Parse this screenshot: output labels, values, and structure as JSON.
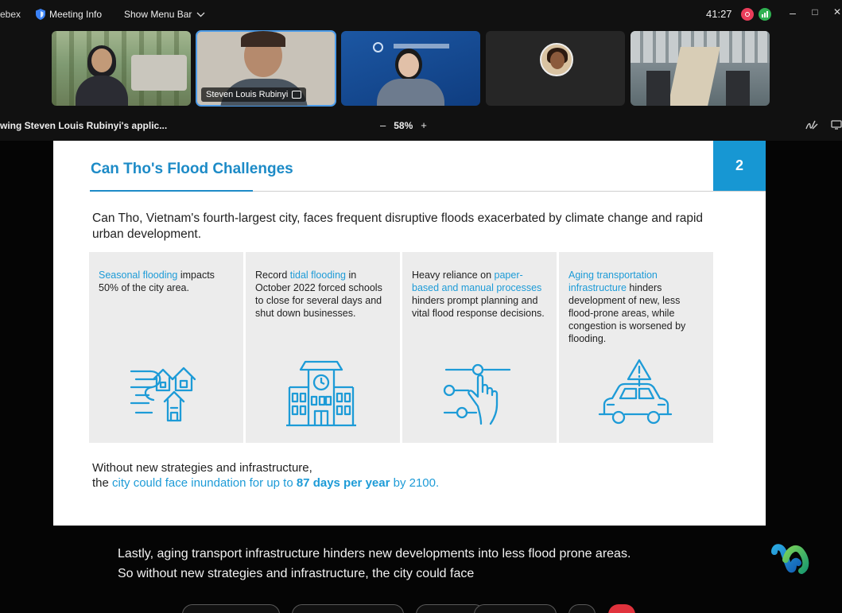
{
  "topbar": {
    "app_name": "ebex",
    "meeting_info": "Meeting Info",
    "show_menu_bar": "Show Menu Bar",
    "timer": "41:27",
    "minimize": "–",
    "maximize": "□",
    "close": "✕",
    "colors": {
      "recording": "#ea3d5a",
      "network": "#2fb151"
    }
  },
  "participants": [
    {
      "name": "",
      "video": "on"
    },
    {
      "name": "Steven Louis Rubinyi",
      "video": "on",
      "active_speaker": true
    },
    {
      "name": "",
      "video": "on"
    },
    {
      "name": "",
      "video": "off",
      "avatar": true
    },
    {
      "name": "",
      "video": "on"
    }
  ],
  "sharebar": {
    "viewing_text": "wing Steven Louis Rubinyi's applic...",
    "zoom_minus": "–",
    "zoom_level": "58%",
    "zoom_plus": "+",
    "annotate_icon": "annotate-icon",
    "more_icon": "share-options-icon"
  },
  "slide": {
    "title": "Can Tho's Flood Challenges",
    "page_number": "2",
    "intro": "Can Tho, Vietnam's fourth-largest city, faces frequent disruptive floods exacerbated by climate change and rapid urban development.",
    "panels": [
      {
        "highlight": "Seasonal flooding",
        "text": " impacts 50% of the city area.",
        "icon": "flooded-houses-icon"
      },
      {
        "pre": "Record ",
        "highlight": "tidal flooding",
        "text": " in October 2022 forced schools to close for several days and shut down businesses.",
        "icon": "school-building-icon"
      },
      {
        "pre": "Heavy reliance on ",
        "highlight": "paper-based and manual processes",
        "text": " hinders prompt planning and vital flood response decisions.",
        "icon": "hand-touch-slider-icon"
      },
      {
        "highlight": "Aging transportation infrastructure",
        "text": " hinders development of new, less flood-prone areas, while congestion is worsened by flooding.",
        "icon": "car-warning-icon"
      }
    ],
    "footer_line1": "Without new strategies and infrastructure,",
    "footer_pre": "the ",
    "footer_hl": "city could face inundation for up to ",
    "footer_bold": "87 days per year",
    "footer_post": " by 2100.",
    "colors": {
      "accent": "#1d8bc7",
      "page_badge": "#1797d3",
      "panel_bg": "#ececec"
    }
  },
  "caption": {
    "line1": "Lastly, aging transport infrastructure hinders new developments into less flood prone areas.",
    "line2": "So without new strategies and infrastructure, the city could face"
  },
  "controls": {
    "end_color": "#e0323c"
  }
}
